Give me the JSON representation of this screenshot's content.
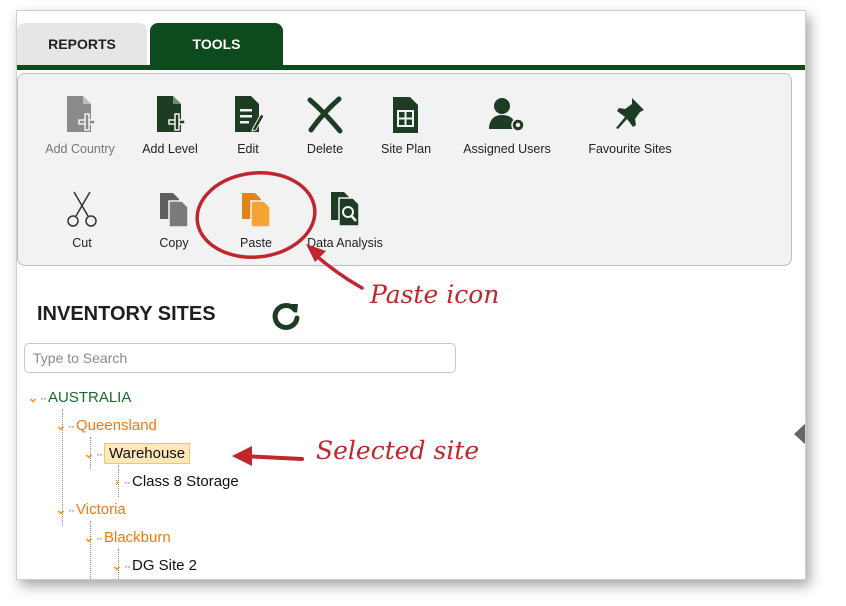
{
  "tabs": [
    {
      "label": "REPORTS",
      "active": false
    },
    {
      "label": "TOOLS",
      "active": true
    }
  ],
  "toolbar": {
    "row1": [
      {
        "label": "Add Country",
        "icon": "add-document-icon",
        "disabled": true
      },
      {
        "label": "Add Level",
        "icon": "add-document-icon"
      },
      {
        "label": "Edit",
        "icon": "edit-document-icon"
      },
      {
        "label": "Delete",
        "icon": "delete-x-icon"
      },
      {
        "label": "Site Plan",
        "icon": "site-plan-icon"
      },
      {
        "label": "Assigned Users",
        "icon": "user-gear-icon"
      },
      {
        "label": "Favourite Sites",
        "icon": "pushpin-icon"
      }
    ],
    "row2": [
      {
        "label": "Cut",
        "icon": "scissors-icon"
      },
      {
        "label": "Copy",
        "icon": "copy-icon"
      },
      {
        "label": "Paste",
        "icon": "paste-icon"
      },
      {
        "label": "Data Analysis",
        "icon": "data-analysis-icon"
      }
    ]
  },
  "inventory": {
    "title": "INVENTORY SITES",
    "refresh_icon": "refresh-icon",
    "search_placeholder": "Type to Search",
    "tree": [
      {
        "label": "AUSTRALIA",
        "level": "country"
      },
      {
        "label": "Queensland",
        "level": "state"
      },
      {
        "label": "Warehouse",
        "level": "site",
        "selected": true
      },
      {
        "label": "Class 8 Storage",
        "level": "sub"
      },
      {
        "label": "Victoria",
        "level": "state"
      },
      {
        "label": "Blackburn",
        "level": "site"
      },
      {
        "label": "DG Site 2",
        "level": "sub"
      }
    ]
  },
  "annotations": {
    "paste": "Paste icon",
    "selected": "Selected site"
  },
  "colors": {
    "brand_green": "#0d4a1c",
    "tree_orange": "#f07a12",
    "annotation_red": "#c0262d",
    "paste_orange": "#f39a1e"
  }
}
